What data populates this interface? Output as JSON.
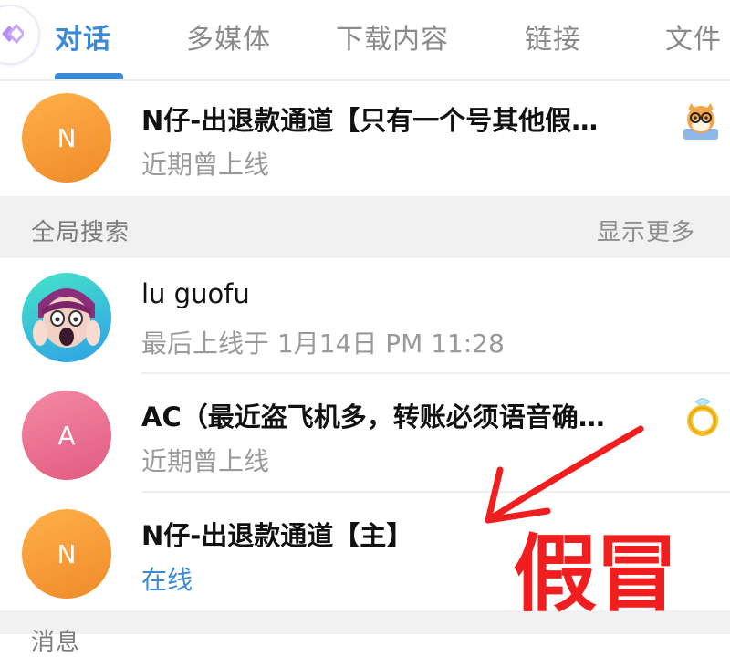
{
  "tabs": [
    {
      "label": "对话",
      "active": true
    },
    {
      "label": "多媒体",
      "active": false
    },
    {
      "label": "下载内容",
      "active": false
    },
    {
      "label": "链接",
      "active": false
    },
    {
      "label": "文件",
      "active": false
    }
  ],
  "top_result": {
    "avatar_letter": "N",
    "name": "N仔-出退款通道【只有一个号其他假…",
    "status": "近期曾上线",
    "badge_icon": "nerd-cat-sticker-icon"
  },
  "global_search": {
    "title": "全局搜索",
    "more_label": "显示更多",
    "results": [
      {
        "avatar": "screaming-face-avatar",
        "name": "lu guofu",
        "status": "最后上线于 1月14日 PM 11:28"
      },
      {
        "avatar_letter": "A",
        "name": "AC（最近盗飞机多，转账必须语音确…",
        "status": "近期曾上线",
        "badge_icon": "ring-emoji-icon"
      },
      {
        "avatar_letter": "N",
        "name": "N仔-出退款通道【主】",
        "status": "在线"
      }
    ]
  },
  "messages_section": {
    "title": "消息"
  },
  "annotation": {
    "text": "假冒",
    "color": "#f01e1e"
  },
  "colors": {
    "accent": "#3a8ad8",
    "section_bg": "#f1f1f1",
    "annotation": "#f01e1e"
  }
}
